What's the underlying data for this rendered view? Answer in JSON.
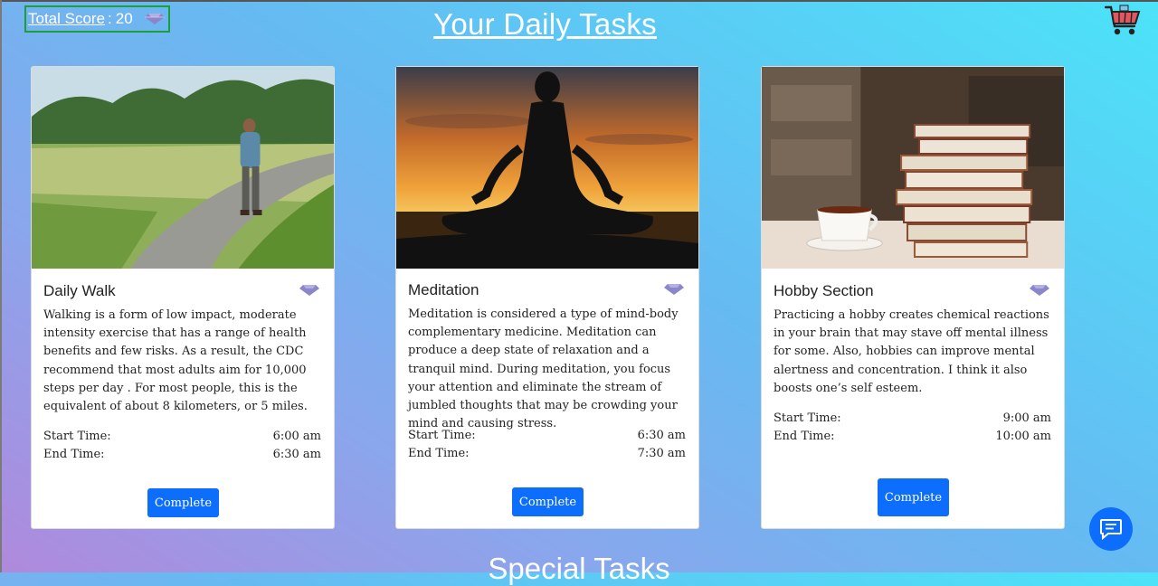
{
  "header": {
    "score_label": "Total Score",
    "score_separator": ":",
    "score_value": "20",
    "title": "Your Daily Tasks",
    "cart_icon": "shopping-cart-icon"
  },
  "tasks": [
    {
      "title": "Daily Walk",
      "description": "Walking is a form of low impact, moderate intensity exercise that has a range of health benefits and few risks. As a result, the CDC recommend that most adults aim for 10,000 steps per day . For most people, this is the equivalent of about 8 kilometers, or 5 miles.",
      "start_label": "Start Time:",
      "start_time": "6:00 am",
      "end_label": "End Time:",
      "end_time": "6:30 am",
      "button_label": "Complete"
    },
    {
      "title": "Meditation",
      "description": "Meditation is considered a type of mind-body complementary medicine. Meditation can produce a deep state of relaxation and a tranquil mind. During meditation, you focus your attention and eliminate the stream of jumbled thoughts that may be crowding your mind and causing stress.",
      "start_label": "Start Time:",
      "start_time": "6:30 am",
      "end_label": "End Time:",
      "end_time": "7:30 am",
      "button_label": "Complete"
    },
    {
      "title": "Hobby Section",
      "description": "Practicing a hobby creates chemical reactions in your brain that may stave off mental illness for some. Also, hobbies can improve mental alertness and concentration. I think it also boosts one’s self esteem.",
      "start_label": "Start Time:",
      "start_time": "9:00 am",
      "end_label": "End Time:",
      "end_time": "10:00 am",
      "button_label": "Complete"
    }
  ],
  "special": {
    "title": "Special Tasks"
  },
  "colors": {
    "accent": "#0d6efd",
    "gem": "#8b86c9",
    "score_border": "#1e9e3a"
  },
  "icons": {
    "gem": "diamond-icon",
    "chat": "chat-icon"
  }
}
